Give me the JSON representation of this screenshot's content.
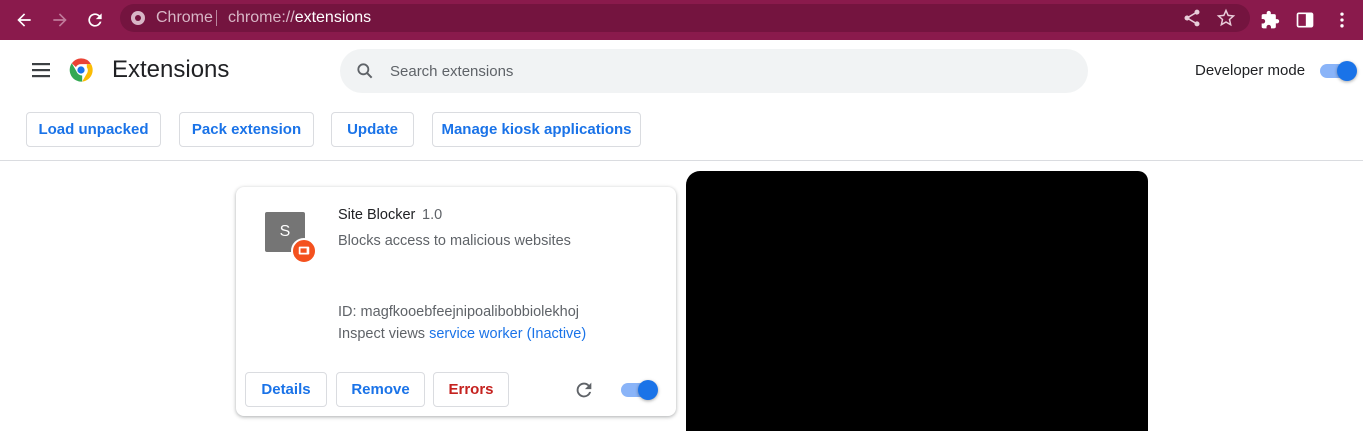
{
  "browser": {
    "chip_label": "Chrome",
    "url_scheme": "chrome://",
    "url_path": "extensions",
    "toolbar_color": "#8a1a4c"
  },
  "header": {
    "title": "Extensions",
    "search_placeholder": "Search extensions",
    "developer_mode_label": "Developer mode",
    "developer_mode_on": true
  },
  "actions": {
    "load_unpacked": "Load unpacked",
    "pack_extension": "Pack extension",
    "update": "Update",
    "manage_kiosk": "Manage kiosk applications"
  },
  "extension": {
    "icon_letter": "S",
    "name": "Site Blocker",
    "version": "1.0",
    "description": "Blocks access to malicious websites",
    "id_line": "ID: magfkooebfeejnipoalibobbiolekhoj",
    "inspect_prefix": "Inspect views",
    "inspect_link": "service worker (Inactive)",
    "details_label": "Details",
    "remove_label": "Remove",
    "errors_label": "Errors",
    "enabled": true
  },
  "colors": {
    "accent": "#1a73e8",
    "error": "#c5221f",
    "badge": "#f4511e"
  }
}
